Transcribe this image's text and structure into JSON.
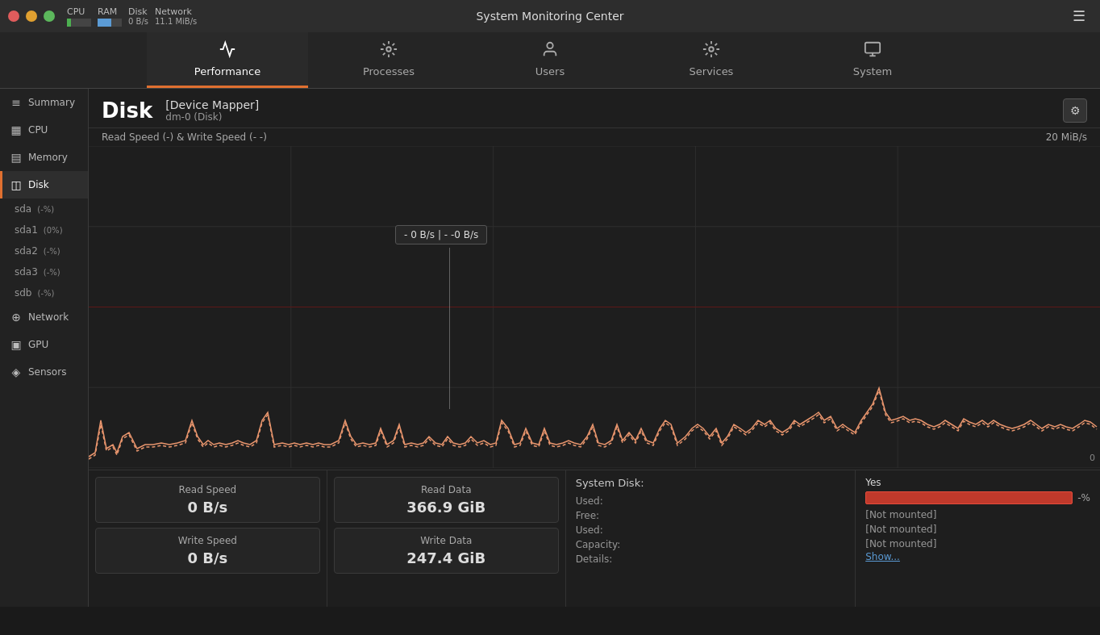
{
  "window": {
    "title": "System Monitoring Center",
    "controls": {
      "close": "×",
      "minimize": "−",
      "maximize": "□"
    }
  },
  "titlebar": {
    "cpu_label": "CPU",
    "ram_label": "RAM",
    "disk_label": "Disk",
    "network_label": "Network",
    "network_value": "11.1 MiB/s",
    "disk_value": "0 B/s",
    "cpu_percent": 15,
    "ram_percent": 55
  },
  "nav_tabs": [
    {
      "id": "performance",
      "label": "Performance",
      "icon": "⟳",
      "active": true
    },
    {
      "id": "processes",
      "label": "Processes",
      "icon": "⚙",
      "active": false
    },
    {
      "id": "users",
      "label": "Users",
      "icon": "🖱",
      "active": false
    },
    {
      "id": "services",
      "label": "Services",
      "icon": "⚙",
      "active": false
    },
    {
      "id": "system",
      "label": "System",
      "icon": "🖥",
      "active": false
    }
  ],
  "sidebar": {
    "items": [
      {
        "id": "summary",
        "label": "Summary",
        "icon": "≡",
        "active": false
      },
      {
        "id": "cpu",
        "label": "CPU",
        "icon": "▦",
        "active": false
      },
      {
        "id": "memory",
        "label": "Memory",
        "icon": "▤",
        "active": false
      },
      {
        "id": "disk",
        "label": "Disk",
        "icon": "◫",
        "active": true
      },
      {
        "id": "network",
        "label": "Network",
        "icon": "⊕",
        "active": false
      },
      {
        "id": "gpu",
        "label": "GPU",
        "icon": "▣",
        "active": false
      },
      {
        "id": "sensors",
        "label": "Sensors",
        "icon": "◈",
        "active": false
      }
    ],
    "disk_subitems": [
      {
        "id": "sda",
        "label": "sda",
        "badge": "(-%)"
      },
      {
        "id": "sda1",
        "label": "sda1",
        "badge": "(0%)"
      },
      {
        "id": "sda2",
        "label": "sda2",
        "badge": "(-%)"
      },
      {
        "id": "sda3",
        "label": "sda3",
        "badge": "(-%)"
      },
      {
        "id": "sdb",
        "label": "sdb",
        "badge": "(-%)"
      }
    ]
  },
  "disk_panel": {
    "title": "Disk",
    "device_name": "[Device Mapper]",
    "device_sub": "dm-0 (Disk)",
    "chart_label": "Read Speed (-) & Write Speed (-  -)",
    "chart_max": "20 MiB/s",
    "chart_min": "0",
    "tooltip": "- 0 B/s  |  - -0 B/s"
  },
  "stats": {
    "read_speed_label": "Read Speed",
    "read_speed_value": "0 B/s",
    "write_speed_label": "Write Speed",
    "write_speed_value": "0 B/s",
    "read_data_label": "Read Data",
    "read_data_value": "366.9 GiB",
    "write_data_label": "Write Data",
    "write_data_value": "247.4 GiB"
  },
  "system_disk": {
    "title": "System Disk:",
    "used_label": "Used:",
    "used_value": "",
    "free_label": "Free:",
    "free_value": "",
    "used2_label": "Used:",
    "used2_value": "",
    "capacity_label": "Capacity:",
    "capacity_value": "",
    "details_label": "Details:",
    "details_value": ""
  },
  "mount_info": {
    "mounted_label": "Yes",
    "percent_label": "-%",
    "not_mounted_1": "[Not mounted]",
    "not_mounted_2": "[Not mounted]",
    "not_mounted_3": "[Not mounted]",
    "show_label": "Show..."
  }
}
